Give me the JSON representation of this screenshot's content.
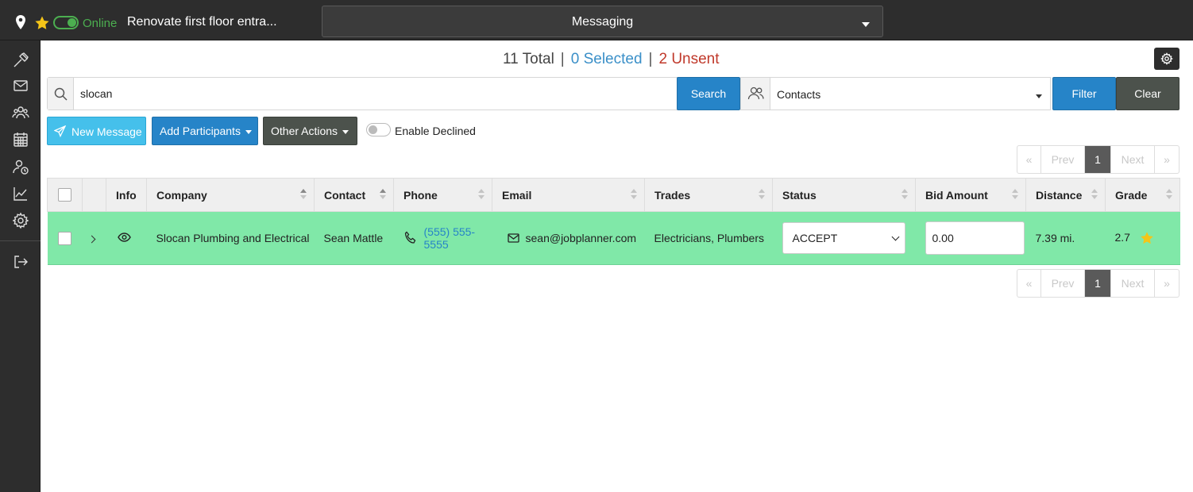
{
  "topbar": {
    "online_label": "Online",
    "project_title": "Renovate first floor entra...",
    "module": "Messaging"
  },
  "summary": {
    "total": "11 Total",
    "selected": "0 Selected",
    "unsent": "2 Unsent",
    "separator": "|"
  },
  "search": {
    "value": "slocan",
    "button_label": "Search"
  },
  "contacts_filter": {
    "value": "Contacts"
  },
  "filter_label": "Filter",
  "clear_label": "Clear",
  "actions": {
    "new_message": "New Message",
    "add_participants": "Add Participants",
    "other_actions": "Other Actions",
    "enable_declined": "Enable Declined"
  },
  "pager": {
    "first": "«",
    "prev": "Prev",
    "page": "1",
    "next": "Next",
    "last": "»"
  },
  "table": {
    "headers": {
      "info": "Info",
      "company": "Company",
      "contact": "Contact",
      "phone": "Phone",
      "email": "Email",
      "trades": "Trades",
      "status": "Status",
      "bid_amount": "Bid Amount",
      "distance": "Distance",
      "grade": "Grade"
    },
    "rows": [
      {
        "company": "Slocan Plumbing and Electrical",
        "contact": "Sean Mattle",
        "phone": "(555) 555-5555",
        "email": "sean@jobplanner.com",
        "trades": "Electricians, Plumbers",
        "status": "ACCEPT",
        "bid_amount": "0.00",
        "distance": "7.39 mi.",
        "grade": "2.7"
      }
    ]
  },
  "colors": {
    "accent_blue": "#2684c8",
    "row_highlight": "#80e8a8",
    "unsent_red": "#c0392b",
    "online_green": "#4caf50"
  }
}
